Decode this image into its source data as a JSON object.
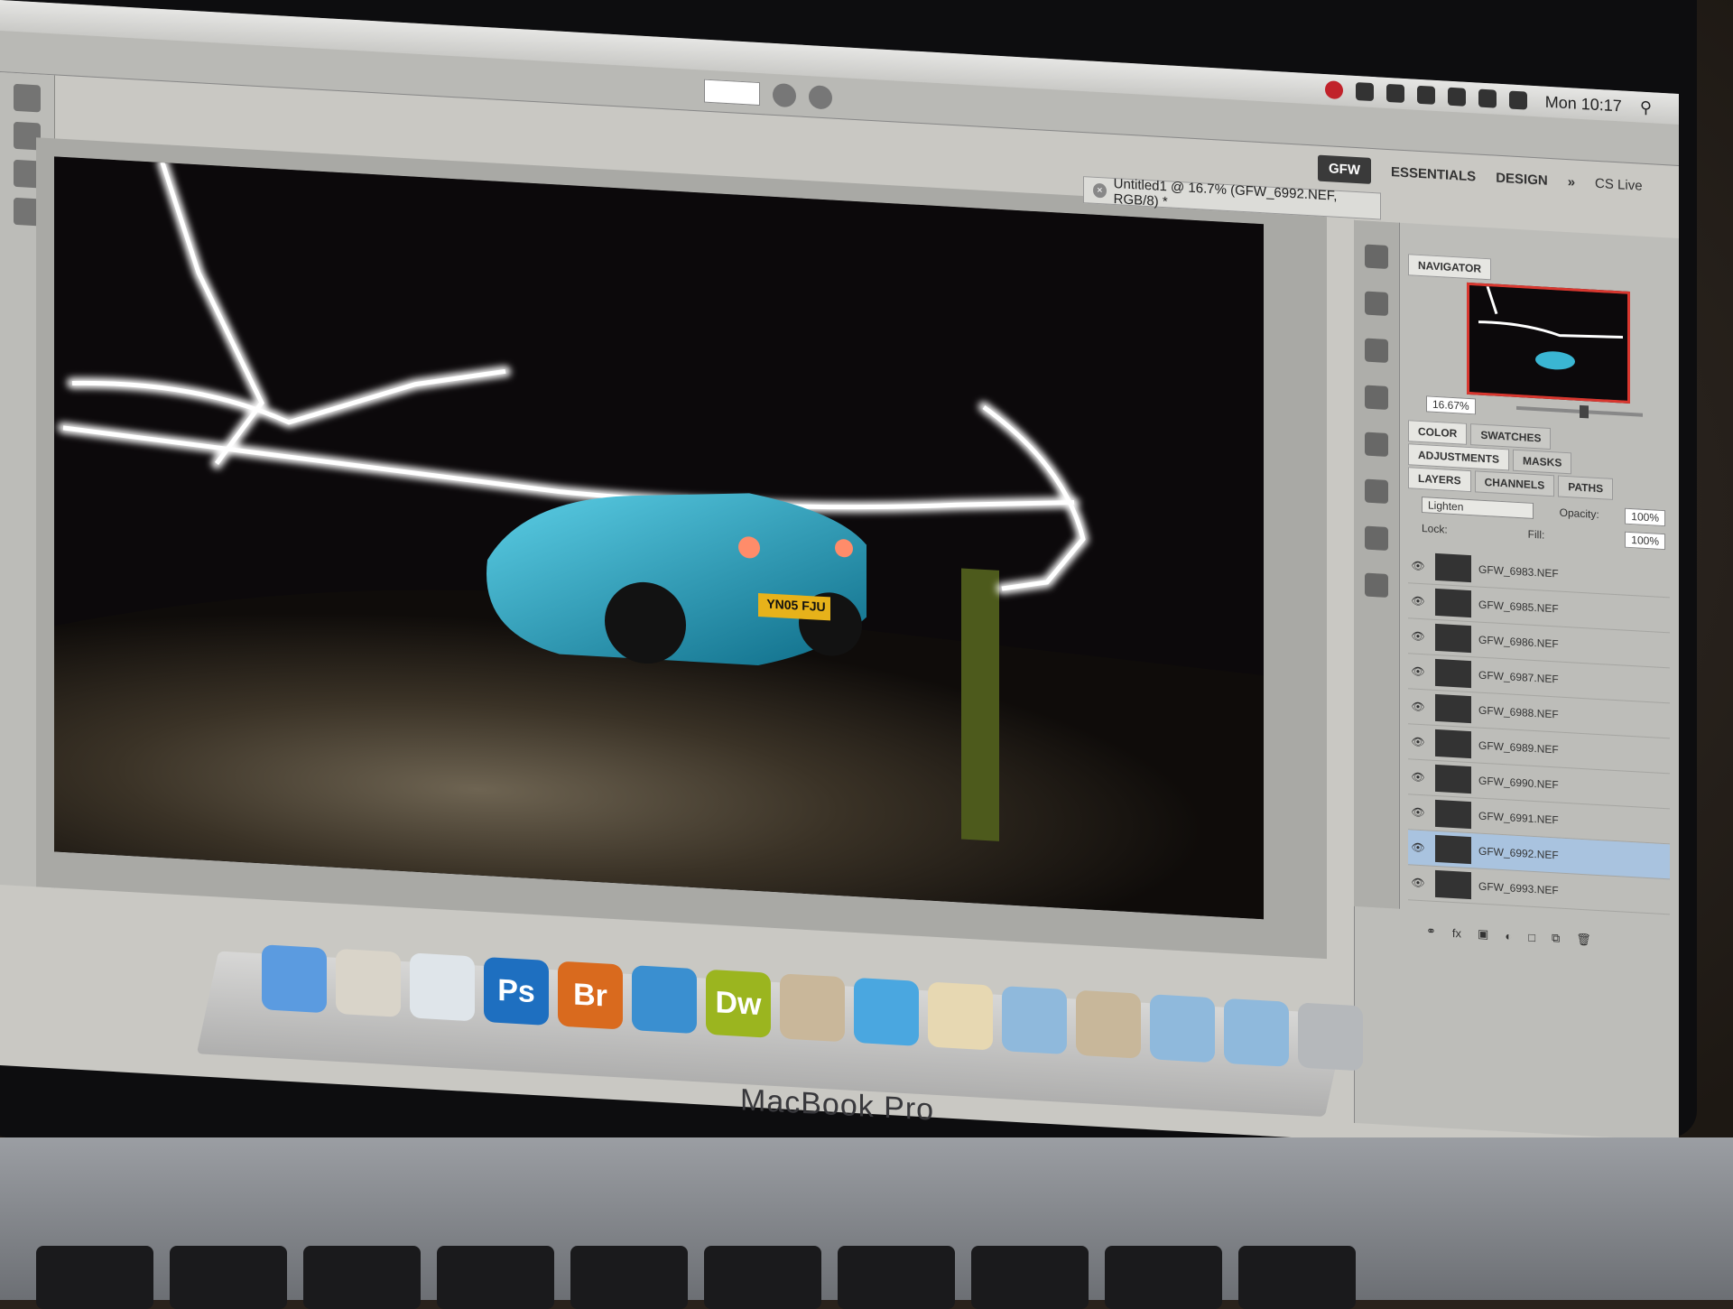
{
  "menubar": {
    "clock": "Mon 10:17"
  },
  "workspace": {
    "active": "GFW",
    "items": [
      "ESSENTIALS",
      "DESIGN",
      "»"
    ],
    "cslive": "CS Live"
  },
  "document": {
    "tab_title": "Untitled1 @ 16.7% (GFW_6992.NEF, RGB/8) *",
    "plate": "YN05 FJU"
  },
  "navigator": {
    "tab": "NAVIGATOR",
    "zoom": "16.67%"
  },
  "panel_tabs": {
    "color": [
      "COLOR",
      "SWATCHES"
    ],
    "adjust": [
      "ADJUSTMENTS",
      "MASKS"
    ],
    "layers": [
      "LAYERS",
      "CHANNELS",
      "PATHS"
    ]
  },
  "layer_controls": {
    "blend": "Lighten",
    "opacity_label": "Opacity:",
    "opacity": "100%",
    "lock_label": "Lock:",
    "fill_label": "Fill:",
    "fill": "100%"
  },
  "layers": [
    {
      "name": "GFW_6983.NEF",
      "selected": false
    },
    {
      "name": "GFW_6985.NEF",
      "selected": false
    },
    {
      "name": "GFW_6986.NEF",
      "selected": false
    },
    {
      "name": "GFW_6987.NEF",
      "selected": false
    },
    {
      "name": "GFW_6988.NEF",
      "selected": false
    },
    {
      "name": "GFW_6989.NEF",
      "selected": false
    },
    {
      "name": "GFW_6990.NEF",
      "selected": false
    },
    {
      "name": "GFW_6991.NEF",
      "selected": false
    },
    {
      "name": "GFW_6992.NEF",
      "selected": true
    },
    {
      "name": "GFW_6993.NEF",
      "selected": false
    }
  ],
  "layer_footer": "fx",
  "dock": [
    {
      "name": "finder-icon",
      "label": "",
      "color": "#5b9be0"
    },
    {
      "name": "dashboard-icon",
      "label": "",
      "color": "#d9d4c9"
    },
    {
      "name": "safari-icon",
      "label": "",
      "color": "#dfe5ea"
    },
    {
      "name": "photoshop-icon",
      "label": "Ps",
      "color": "#1e6fc0"
    },
    {
      "name": "bridge-icon",
      "label": "Br",
      "color": "#d96a1e"
    },
    {
      "name": "itunes-icon",
      "label": "",
      "color": "#3a8fd0"
    },
    {
      "name": "dreamweaver-icon",
      "label": "Dw",
      "color": "#9bb51f"
    },
    {
      "name": "iphoto-icon",
      "label": "",
      "color": "#c9b79a"
    },
    {
      "name": "mail-icon",
      "label": "",
      "color": "#4aa7e0"
    },
    {
      "name": "preview-icon",
      "label": "",
      "color": "#e7d8b2"
    },
    {
      "name": "folder-icon",
      "label": "",
      "color": "#8fb9dc"
    },
    {
      "name": "image-icon",
      "label": "",
      "color": "#c8b79a"
    },
    {
      "name": "folder-icon",
      "label": "",
      "color": "#8fb9dc"
    },
    {
      "name": "downloads-folder-icon",
      "label": "",
      "color": "#8fb9dc"
    },
    {
      "name": "trash-icon",
      "label": "",
      "color": "#b5b8bb"
    }
  ],
  "brand": "MacBook Pro"
}
